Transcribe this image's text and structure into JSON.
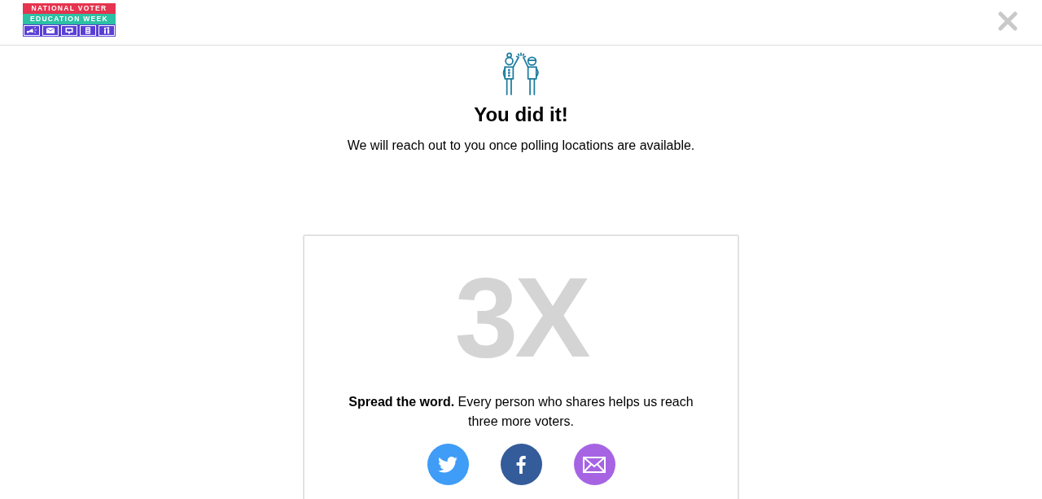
{
  "header": {
    "logo": {
      "line_1": "NATIONAL VOTER",
      "line_2": "EDUCATION WEEK",
      "tiles": [
        {
          "kind": "megaphone"
        },
        {
          "kind": "envelope"
        },
        {
          "kind": "screen"
        },
        {
          "kind": "list"
        },
        {
          "kind": "people"
        }
      ]
    }
  },
  "confirmation": {
    "title": "You did it!",
    "message": "We will reach out to you once polling locations are available."
  },
  "share_card": {
    "multiplier": "3X",
    "text": "**Spread the word.** Every person who shares helps us reach three more voters.",
    "share_buttons": [
      {
        "kind": "twitter",
        "color": "#3f9cf7"
      },
      {
        "kind": "facebook",
        "color": "#345c9b"
      },
      {
        "kind": "email",
        "color": "#a664e3"
      }
    ]
  }
}
